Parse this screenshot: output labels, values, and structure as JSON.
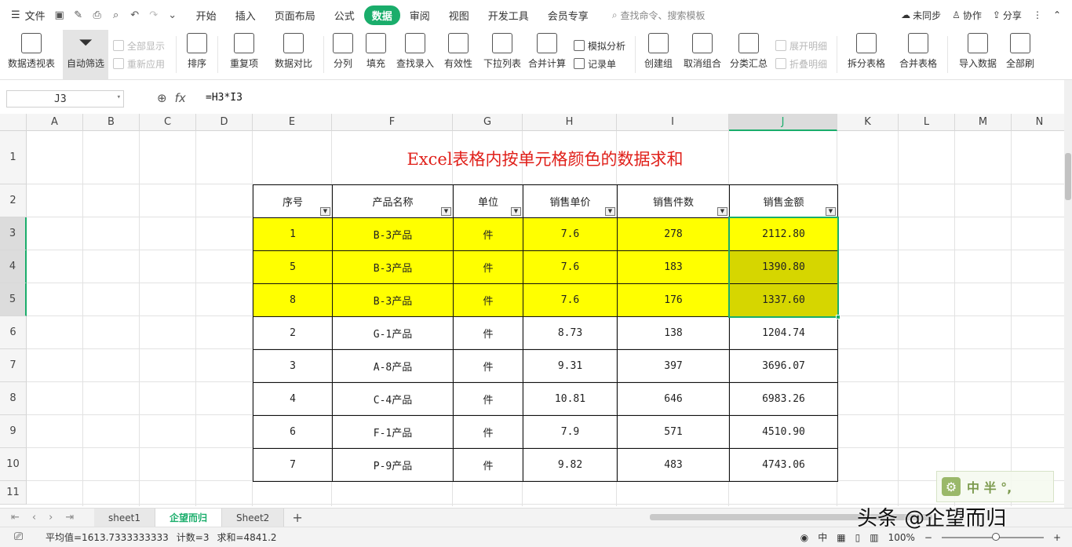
{
  "menu": {
    "file_label": "文件",
    "tabs": [
      "开始",
      "插入",
      "页面布局",
      "公式",
      "数据",
      "审阅",
      "视图",
      "开发工具",
      "会员专享"
    ],
    "active_tab": "数据",
    "search_placeholder": "查找命令、搜索模板",
    "sync_label": "未同步",
    "collab_label": "协作",
    "share_label": "分享"
  },
  "ribbon": {
    "pivot": "数据透视表",
    "autofilter": "自动筛选",
    "show_all": "全部显示",
    "reapply": "重新应用",
    "sort": "排序",
    "duplicates": "重复项",
    "compare": "数据对比",
    "split": "分列",
    "fill": "填充",
    "lookup_entry": "查找录入",
    "validity": "有效性",
    "dropdown_list": "下拉列表",
    "consolidate": "合并计算",
    "simulate": "模拟分析",
    "record_sheet": "记录单",
    "group": "创建组",
    "ungroup": "取消组合",
    "subtotal": "分类汇总",
    "expand_detail": "展开明细",
    "collapse_detail": "折叠明细",
    "split_table": "拆分表格",
    "merge_table": "合并表格",
    "import_data": "导入数据",
    "refresh_all": "全部刷"
  },
  "formula_bar": {
    "name_box": "J3",
    "fx": "fx",
    "formula": "=H3*I3"
  },
  "columns": [
    "A",
    "B",
    "C",
    "D",
    "E",
    "F",
    "G",
    "H",
    "I",
    "J",
    "K",
    "L",
    "M",
    "N"
  ],
  "rows": [
    "1",
    "2",
    "3",
    "4",
    "5",
    "6",
    "7",
    "8",
    "9",
    "10",
    "11"
  ],
  "sheet": {
    "title": "Excel表格内按单元格颜色的数据求和",
    "headers": [
      "序号",
      "产品名称",
      "单位",
      "销售单价",
      "销售件数",
      "销售金额"
    ],
    "data": [
      [
        "1",
        "B-3产品",
        "件",
        "7.6",
        "278",
        "2112.80"
      ],
      [
        "5",
        "B-3产品",
        "件",
        "7.6",
        "183",
        "1390.80"
      ],
      [
        "8",
        "B-3产品",
        "件",
        "7.6",
        "176",
        "1337.60"
      ],
      [
        "2",
        "G-1产品",
        "件",
        "8.73",
        "138",
        "1204.74"
      ],
      [
        "3",
        "A-8产品",
        "件",
        "9.31",
        "397",
        "3696.07"
      ],
      [
        "4",
        "C-4产品",
        "件",
        "10.81",
        "646",
        "6983.26"
      ],
      [
        "6",
        "F-1产品",
        "件",
        "7.9",
        "571",
        "4510.90"
      ],
      [
        "7",
        "P-9产品",
        "件",
        "9.82",
        "483",
        "4743.06"
      ]
    ],
    "highlight_color": "#ffff00",
    "title_color": "#e0201a"
  },
  "sheet_tabs": [
    "sheet1",
    "企望而归",
    "Sheet2"
  ],
  "active_sheet": "企望而归",
  "status": {
    "average": "平均值=1613.7333333333",
    "count": "计数=3",
    "sum": "求和=4841.2",
    "zoom": "100%"
  },
  "watermark": {
    "logo_text": "中 半 °,",
    "credit": "头条 @企望而归"
  },
  "colors": {
    "accent": "#1aad6b"
  }
}
